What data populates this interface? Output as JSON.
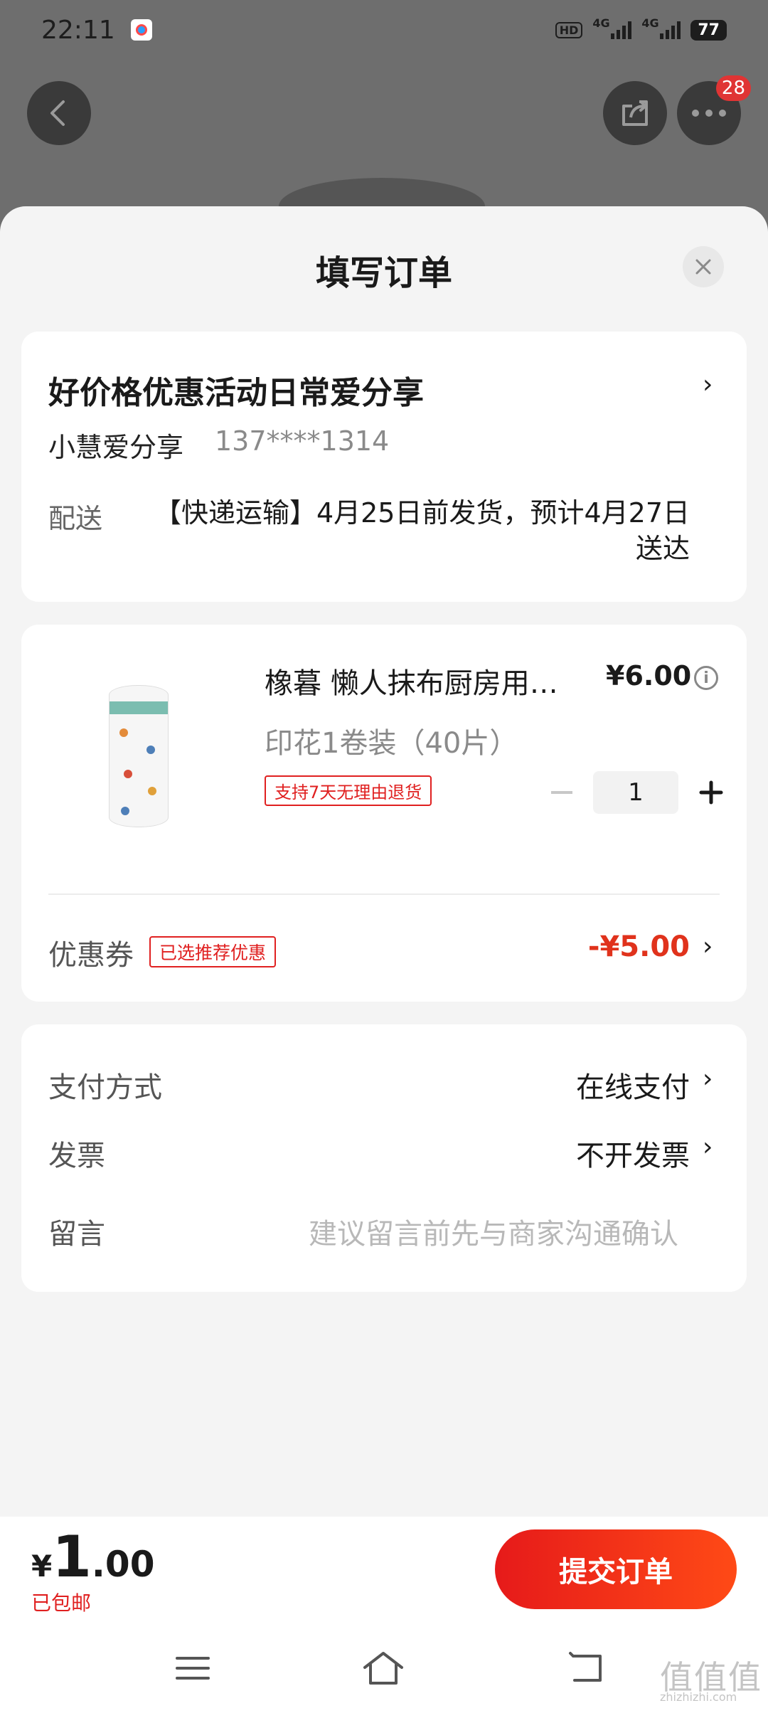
{
  "status_bar": {
    "time": "22:11",
    "hd": "HD",
    "net1": "4G",
    "net2": "4G",
    "battery": "77"
  },
  "header": {
    "more_badge": "28"
  },
  "sheet": {
    "title": "填写订单"
  },
  "address": {
    "title": "好价格优惠活动日常爱分享",
    "name": "小慧爱分享",
    "phone": "137****1314",
    "shipping_label": "配送",
    "shipping_text": "【快递运输】4月25日前发货，预计4月27日送达"
  },
  "product": {
    "name": "橡暮  懒人抹布厨房用…",
    "price": "¥6.00",
    "spec": "印花1卷装（40片）",
    "return_tag": "支持7天无理由退货",
    "quantity": "1"
  },
  "coupon": {
    "label": "优惠券",
    "tag": "已选推荐优惠",
    "amount": "-¥5.00"
  },
  "settings": {
    "payment_label": "支付方式",
    "payment_value": "在线支付",
    "invoice_label": "发票",
    "invoice_value": "不开发票",
    "note_label": "留言",
    "note_placeholder": "建议留言前先与商家沟通确认"
  },
  "footer": {
    "currency": "¥",
    "total_int": "1",
    "total_dec": ".00",
    "free_shipping": "已包邮",
    "submit_label": "提交订单"
  },
  "watermark": {
    "main": "值值值",
    "sub": "zhizhizhi.com"
  },
  "colors": {
    "accent": "#e0321c",
    "button_start": "#e61a1a",
    "button_end": "#ff4a16"
  }
}
